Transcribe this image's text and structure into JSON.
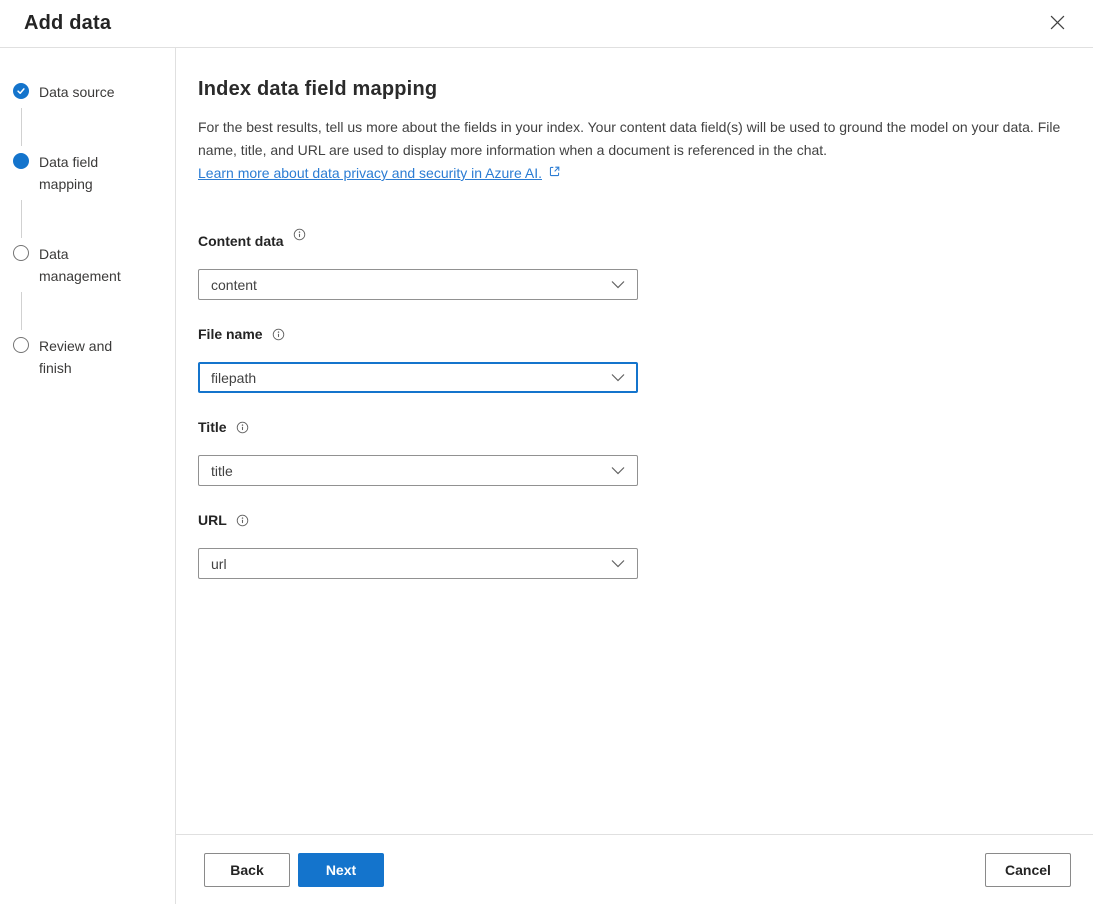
{
  "header": {
    "title": "Add data"
  },
  "colors": {
    "accent_blue": "#1474cc",
    "link_blue": "#2b7cd3",
    "divider_gray": "#e0e0e0",
    "input_border_gray": "#919191"
  },
  "wizard_steps": [
    {
      "label": "Data source",
      "state": "completed"
    },
    {
      "label": "Data field mapping",
      "state": "current"
    },
    {
      "label": "Data management",
      "state": "upcoming"
    },
    {
      "label": "Review and finish",
      "state": "upcoming"
    }
  ],
  "main": {
    "heading": "Index data field mapping",
    "description": "For the best results, tell us more about the fields in your index. Your content data field(s) will be used to ground the model on your data. File name, title, and URL are used to display more information when a document is referenced in the chat.",
    "learn_more_link": "Learn more about data privacy and security in Azure AI.",
    "fields": [
      {
        "label": "Content data",
        "value": "content",
        "focused": false
      },
      {
        "label": "File name",
        "value": "filepath",
        "focused": true
      },
      {
        "label": "Title",
        "value": "title",
        "focused": false
      },
      {
        "label": "URL",
        "value": "url",
        "focused": false
      }
    ]
  },
  "footer": {
    "back_label": "Back",
    "next_label": "Next",
    "cancel_label": "Cancel"
  }
}
